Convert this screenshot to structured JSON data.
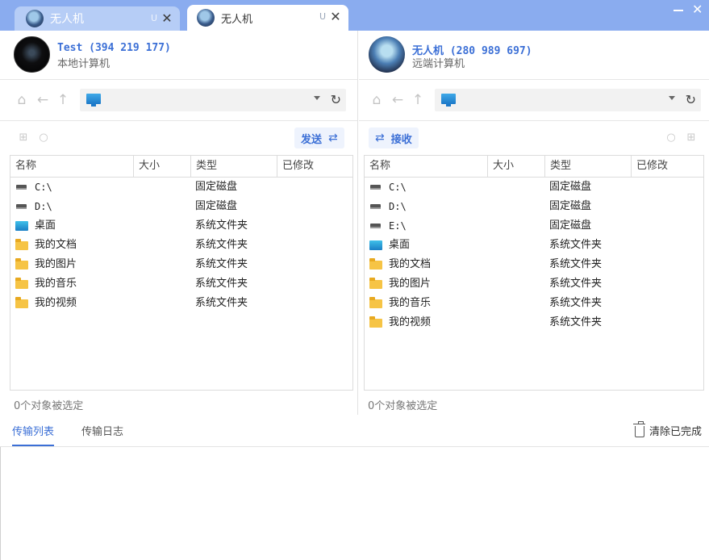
{
  "tabs": [
    {
      "title": "无人机",
      "badge": "U",
      "active": false
    },
    {
      "title": "无人机",
      "badge": "U",
      "active": true
    }
  ],
  "window": {
    "close_glyph": "✕"
  },
  "local": {
    "host_name": "Test (394 219 177)",
    "host_sub": "本地计算机",
    "action_label": "发送",
    "status": "0个对象被选定",
    "columns": [
      "名称",
      "大小",
      "类型",
      "已修改"
    ],
    "rows": [
      {
        "icon": "drive-icon",
        "name": "C:\\",
        "type": "固定磁盘"
      },
      {
        "icon": "drive-icon",
        "name": "D:\\",
        "type": "固定磁盘"
      },
      {
        "icon": "desktop-icon",
        "name": "桌面",
        "type": "系统文件夹"
      },
      {
        "icon": "folder-icon",
        "name": "我的文档",
        "type": "系统文件夹"
      },
      {
        "icon": "folder-icon",
        "name": "我的图片",
        "type": "系统文件夹"
      },
      {
        "icon": "folder-icon",
        "name": "我的音乐",
        "type": "系统文件夹"
      },
      {
        "icon": "folder-icon",
        "name": "我的视频",
        "type": "系统文件夹"
      }
    ]
  },
  "remote": {
    "host_name": "无人机 (280 989 697)",
    "host_sub": "远端计算机",
    "action_label": "接收",
    "status": "0个对象被选定",
    "columns": [
      "名称",
      "大小",
      "类型",
      "已修改"
    ],
    "rows": [
      {
        "icon": "drive-icon",
        "name": "C:\\",
        "type": "固定磁盘"
      },
      {
        "icon": "drive-icon",
        "name": "D:\\",
        "type": "固定磁盘"
      },
      {
        "icon": "drive-icon",
        "name": "E:\\",
        "type": "固定磁盘"
      },
      {
        "icon": "desktop-icon",
        "name": "桌面",
        "type": "系统文件夹"
      },
      {
        "icon": "folder-icon",
        "name": "我的文档",
        "type": "系统文件夹"
      },
      {
        "icon": "folder-icon",
        "name": "我的图片",
        "type": "系统文件夹"
      },
      {
        "icon": "folder-icon",
        "name": "我的音乐",
        "type": "系统文件夹"
      },
      {
        "icon": "folder-icon",
        "name": "我的视频",
        "type": "系统文件夹"
      }
    ]
  },
  "transfer": {
    "tabs": [
      "传输列表",
      "传输日志"
    ],
    "clear_label": "清除已完成"
  },
  "colors": {
    "accent": "#3b6fd6",
    "titlebar": "#8aacef"
  }
}
